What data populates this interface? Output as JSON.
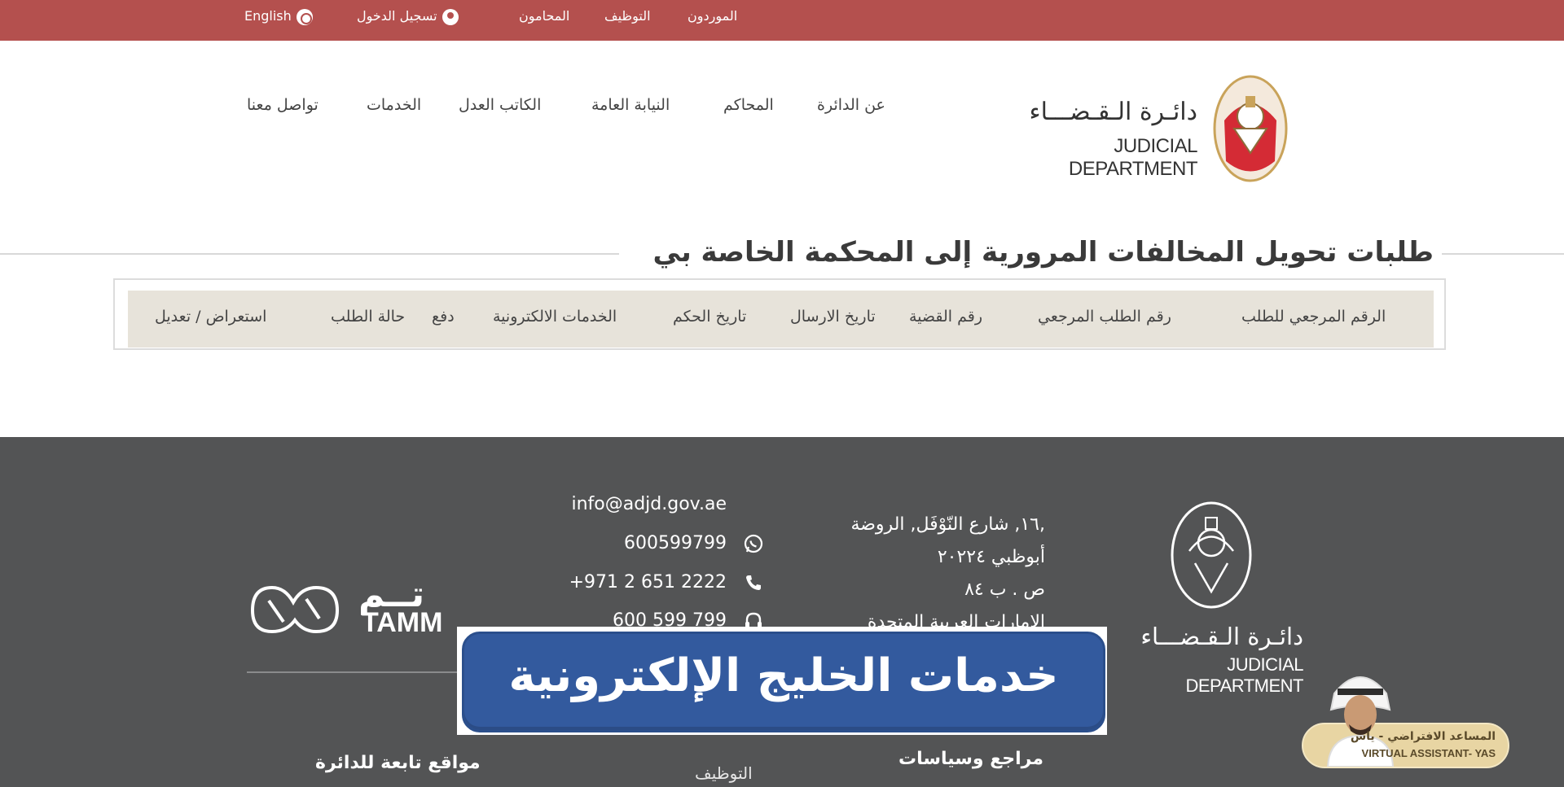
{
  "topbar": {
    "language": "English",
    "login": "تسجيل الدخول",
    "lawyers": "المحامون",
    "careers": "التوظيف",
    "suppliers": "الموردون"
  },
  "header": {
    "logo_ar": "دائـرة الـقـضـــاء",
    "logo_en": "JUDICIAL DEPARTMENT",
    "nav": {
      "about": "عن الدائرة",
      "courts": "المحاكم",
      "prosecution": "النيابة العامة",
      "notary": "الكاتب العدل",
      "services": "الخدمات",
      "contact": "تواصل معنا"
    }
  },
  "main": {
    "title": "طلبات تحويل المخالفات المرورية إلى المحكمة الخاصة بي",
    "table_headers": {
      "ref_number": "الرقم المرجعي للطلب",
      "req_ref_number": "رقم الطلب المرجعي",
      "case_number": "رقم القضية",
      "send_date": "تاريخ الارسال",
      "judgment_date": "تاريخ الحكم",
      "e_services": "الخدمات الالكترونية",
      "payment": "دفع",
      "status": "حالة الطلب",
      "view_edit": "استعراض / تعديل"
    }
  },
  "footer": {
    "email": "info@adjd.gov.ae",
    "whatsapp": "600599799",
    "phone": "+971 2 651 2222",
    "call_center": "600 599 799",
    "address": {
      "line1": "١٦, شارع النّوْفَل, الروضة,",
      "line2": "أبوظبي ٢٠٢٢٤",
      "line3": "ص . ب ٨٤",
      "line4": "الامارات العربية المتحدة"
    },
    "logo_ar": "دائـرة الـقـضـــاء",
    "logo_en": "JUDICIAL DEPARTMENT",
    "tamm_ar": "تــم",
    "tamm_en": "TAMM",
    "heading_policies": "مراجع وسياسات",
    "heading_affiliates": "مواقع تابعة للدائرة",
    "link_careers": "التوظيف"
  },
  "banner": {
    "text": "خدمات الخليج الإلكترونية"
  },
  "virtual_assistant": {
    "label_ar": "المساعد الافتراضي - ياس",
    "label_en": "VIRTUAL ASSISTANT- YAS"
  },
  "colors": {
    "topbar": "#b4504e",
    "footer": "#535455",
    "banner": "#335a9e",
    "table_head": "#e7e3da"
  },
  "icons": [
    "globe-icon",
    "user-icon",
    "whatsapp-icon",
    "phone-icon",
    "headset-icon",
    "falcon-emblem-icon",
    "tamm-logo-icon"
  ]
}
